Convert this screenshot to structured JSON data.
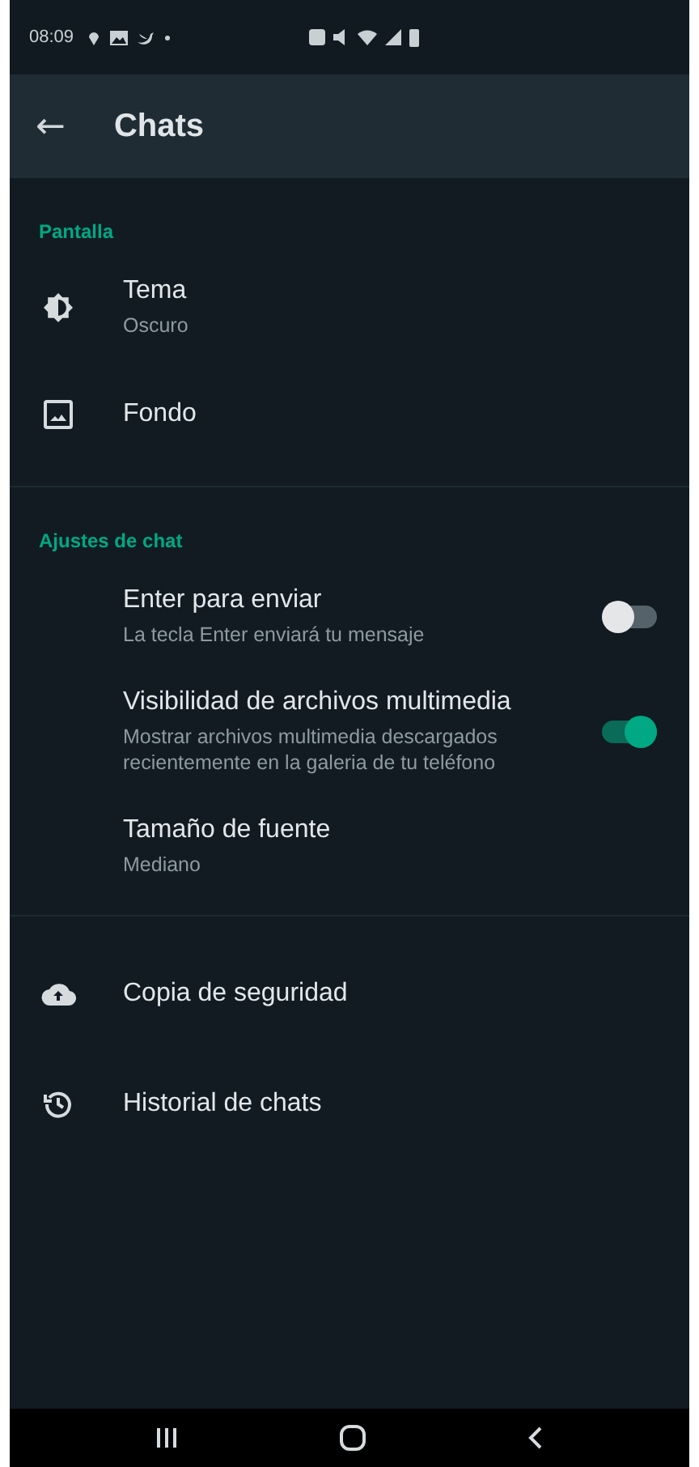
{
  "status_bar": {
    "time": "08:09"
  },
  "app_bar": {
    "back": "←",
    "title": "Chats"
  },
  "sections": [
    {
      "title": "Pantalla",
      "items": [
        {
          "kind": "icon",
          "title": "Tema",
          "subtitle": "Oscuro"
        },
        {
          "kind": "icon",
          "title": "Fondo"
        }
      ]
    },
    {
      "title": "Ajustes de chat",
      "items": [
        {
          "kind": "toggle",
          "title": "Enter para enviar",
          "subtitle": "La tecla Enter enviará tu mensaje",
          "on": false
        },
        {
          "kind": "toggle",
          "title": "Visibilidad de archivos multimedia",
          "subtitle": "Mostrar archivos multimedia descargados recientemente en la galeria de tu teléfono",
          "on": true
        },
        {
          "kind": "plain",
          "title": "Tamaño de fuente",
          "subtitle": "Mediano"
        }
      ]
    },
    {
      "items": [
        {
          "kind": "icon",
          "title": "Copia de seguridad"
        },
        {
          "kind": "icon",
          "title": "Historial de chats"
        }
      ]
    }
  ]
}
